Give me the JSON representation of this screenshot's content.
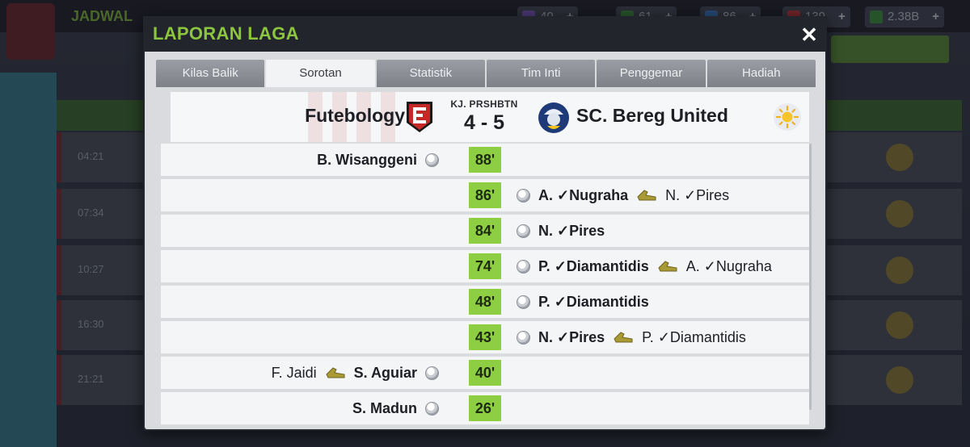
{
  "background": {
    "title": "JADWAL",
    "resources": [
      {
        "value": "40",
        "color": "#7b5cc4",
        "icon": "coin-icon"
      },
      {
        "value": "61",
        "color": "#3f8f3f",
        "icon": "token-icon"
      },
      {
        "value": "86",
        "color": "#3d7bc4",
        "icon": "energy-icon"
      },
      {
        "value": "139",
        "color": "#c43a3a",
        "icon": "medical-icon"
      },
      {
        "value": "2.38B",
        "color": "#3f8f3f",
        "icon": "money-icon"
      }
    ],
    "row_times": [
      "04:21",
      "07:34",
      "10:27",
      "16:30",
      "21:21"
    ]
  },
  "dialog": {
    "title": "LAPORAN LAGA",
    "close_label": "✕",
    "tabs": [
      {
        "label": "Kilas Balik",
        "active": false
      },
      {
        "label": "Sorotan",
        "active": true
      },
      {
        "label": "Statistik",
        "active": false
      },
      {
        "label": "Tim Inti",
        "active": false
      },
      {
        "label": "Penggemar",
        "active": false
      },
      {
        "label": "Hadiah",
        "active": false
      }
    ],
    "match": {
      "home_team": "Futebology",
      "competition_label": "KJ. PRSHBTN",
      "score": "4 - 5",
      "away_team": "SC. Bereg United",
      "weather_icon": "sun-icon"
    },
    "events": [
      {
        "minute": "88'",
        "side": "home",
        "scorer": "B. Wisanggeni",
        "assist": ""
      },
      {
        "minute": "86'",
        "side": "away",
        "scorer": "A. ✓Nugraha",
        "assist": "N. ✓Pires"
      },
      {
        "minute": "84'",
        "side": "away",
        "scorer": "N. ✓Pires",
        "assist": ""
      },
      {
        "minute": "74'",
        "side": "away",
        "scorer": "P. ✓Diamantidis",
        "assist": "A. ✓Nugraha"
      },
      {
        "minute": "48'",
        "side": "away",
        "scorer": "P. ✓Diamantidis",
        "assist": ""
      },
      {
        "minute": "43'",
        "side": "away",
        "scorer": "N. ✓Pires",
        "assist": "P. ✓Diamantidis"
      },
      {
        "minute": "40'",
        "side": "home",
        "scorer": "S. Aguiar",
        "assist": "F. Jaidi"
      },
      {
        "minute": "26'",
        "side": "home",
        "scorer": "S. Madun",
        "assist": ""
      }
    ]
  }
}
